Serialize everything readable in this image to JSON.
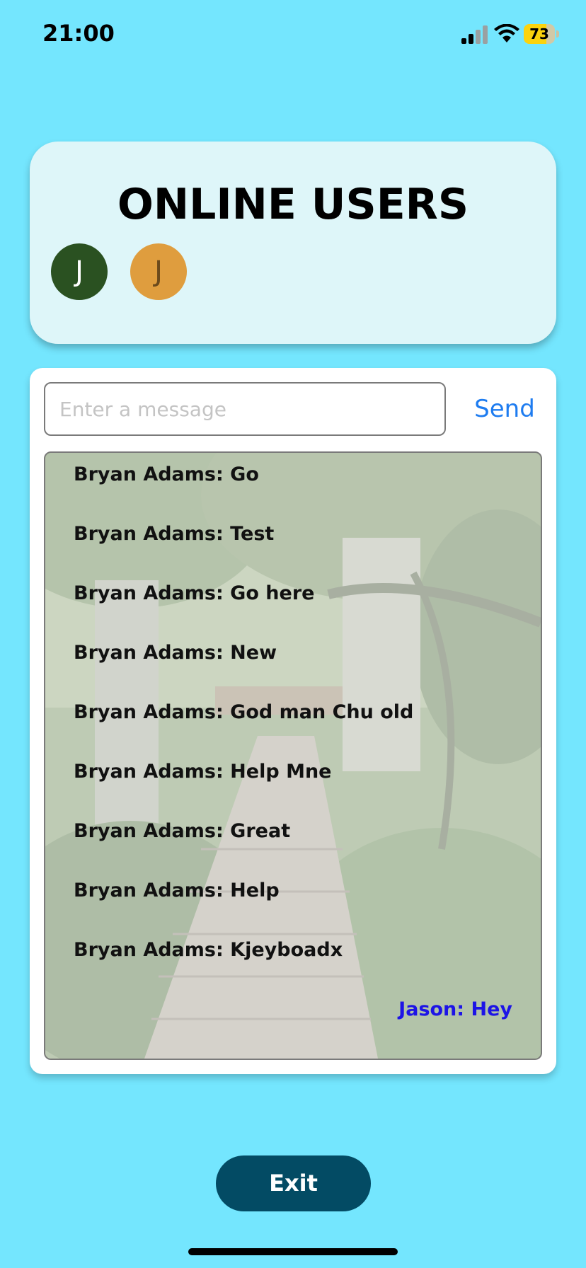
{
  "status_bar": {
    "time": "21:00",
    "battery_level": "73",
    "battery_fraction": 0.73,
    "icons": [
      "signal-icon",
      "wifi-icon",
      "battery-icon"
    ]
  },
  "online_users": {
    "title": "ONLINE USERS",
    "users": [
      {
        "initial": "J",
        "bg_color": "#2a5121",
        "text_color": "#ffffff"
      },
      {
        "initial": "J",
        "bg_color": "#df9d3e",
        "text_color": "#6b4a1c"
      }
    ]
  },
  "composer": {
    "placeholder": "Enter a message",
    "value": "",
    "send_label": "Send",
    "send_color": "#1e7cf0"
  },
  "messages": [
    {
      "text": "Bryan Adams: Go",
      "own": false
    },
    {
      "text": "Bryan Adams: Test",
      "own": false
    },
    {
      "text": "Bryan Adams: Go here",
      "own": false
    },
    {
      "text": "Bryan Adams: New",
      "own": false
    },
    {
      "text": "Bryan Adams: God man Chu old",
      "own": false
    },
    {
      "text": "Bryan Adams: Help Mne",
      "own": false
    },
    {
      "text": "Bryan Adams: Great",
      "own": false
    },
    {
      "text": "Bryan Adams: Help",
      "own": false
    },
    {
      "text": "Bryan Adams: Kjeyboadx",
      "own": false
    },
    {
      "text": "Jason: Hey",
      "own": true
    }
  ],
  "message_colors": {
    "other": "#111111",
    "own": "#1d14e6"
  },
  "exit_button": {
    "label": "Exit",
    "bg_color": "#034b64"
  },
  "colors": {
    "background": "#74e6fe",
    "online_card": "#def6f9",
    "chat_card": "#ffffff"
  }
}
